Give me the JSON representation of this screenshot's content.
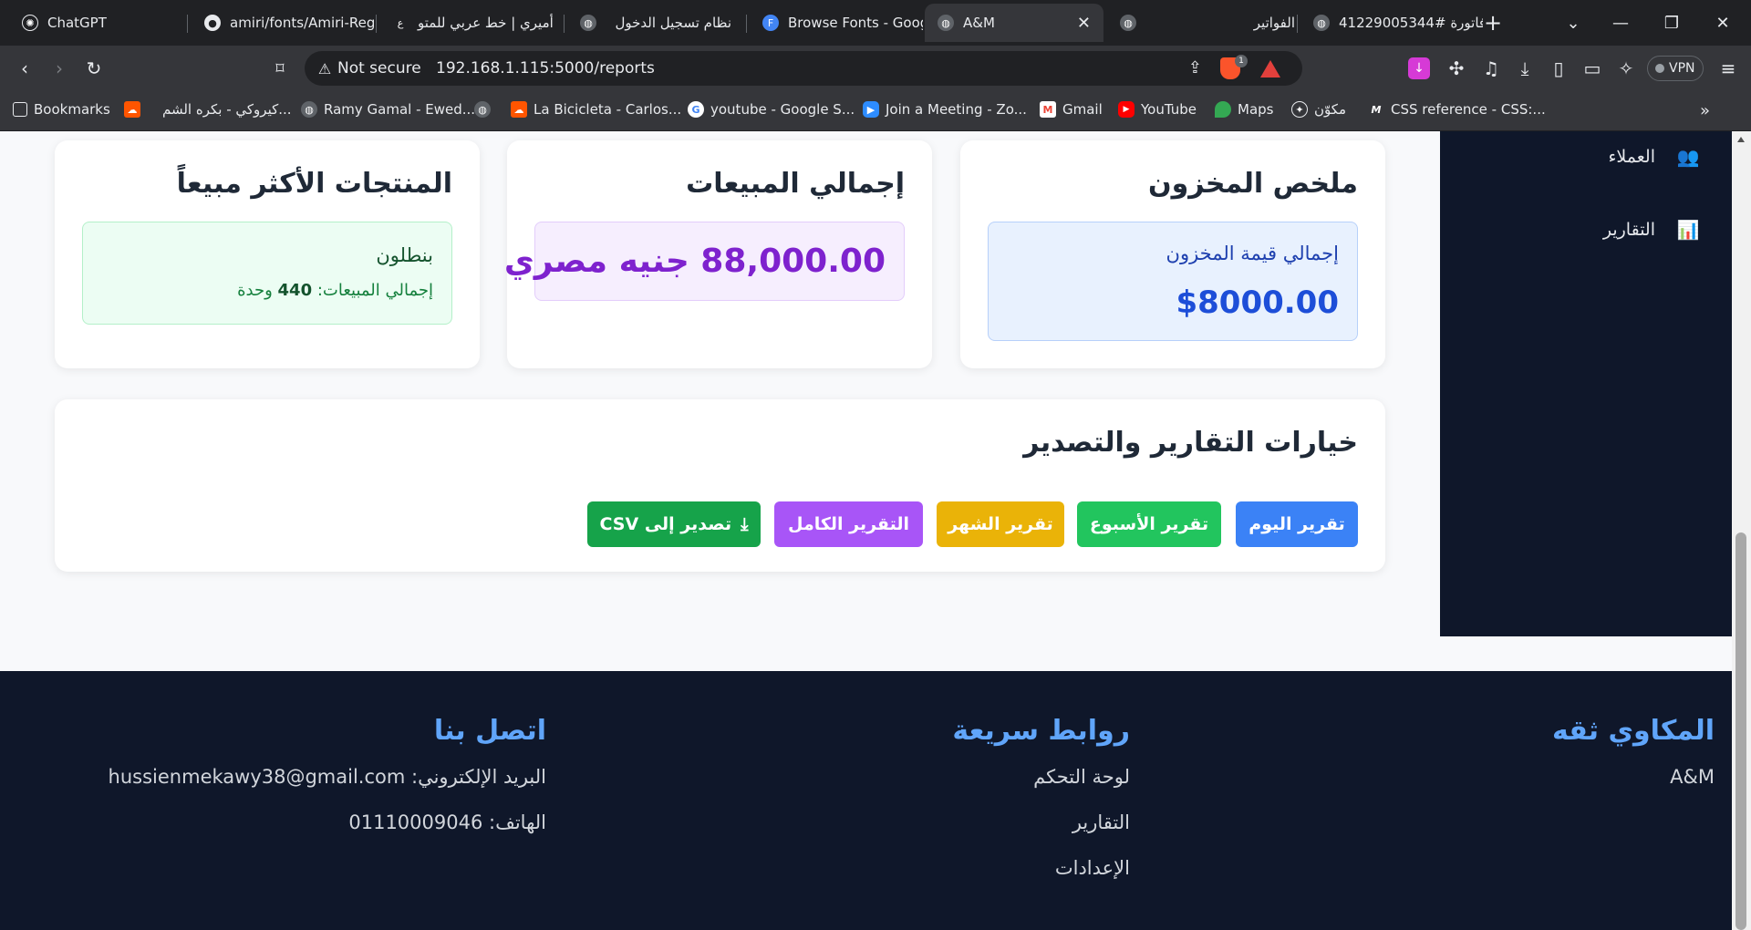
{
  "browser": {
    "tabs": [
      {
        "title": "ChatGPT"
      },
      {
        "title": "amiri/fonts/Amiri-Reg"
      },
      {
        "title": "أميري | خط عربي للمتو"
      },
      {
        "title": "نظام تسجيل الدخول"
      },
      {
        "title": "Browse Fonts - Goog"
      },
      {
        "title": "A&M"
      },
      {
        "title": "الفواتير"
      },
      {
        "title": "فاتورة #41229005344"
      }
    ],
    "address": {
      "security_label": "Not secure",
      "url": "192.168.1.115:5000/reports"
    },
    "brave_badge": "1",
    "vpn_label": "VPN",
    "bookmarks": [
      {
        "label": "Bookmarks"
      },
      {
        "label": "كيروكي - بكره الشم..."
      },
      {
        "label": "Ramy Gamal - Ewed..."
      },
      {
        "label": "La Bicicleta - Carlos..."
      },
      {
        "label": "youtube - Google S..."
      },
      {
        "label": "Join a Meeting - Zo..."
      },
      {
        "label": "Gmail"
      },
      {
        "label": "YouTube"
      },
      {
        "label": "Maps"
      },
      {
        "label": "مكوّن"
      },
      {
        "label": "CSS reference - CSS:..."
      }
    ]
  },
  "sidebar": {
    "items": [
      {
        "label": "العملاء",
        "icon": "users-icon"
      },
      {
        "label": "التقارير",
        "icon": "report-icon"
      }
    ]
  },
  "cards": {
    "inventory": {
      "title": "ملخص المخزون",
      "label": "إجمالي قيمة المخزون",
      "value": "$8000.00"
    },
    "sales": {
      "title": "إجمالي المبيعات",
      "value": "88,000.00 جنيه مصري"
    },
    "top_products": {
      "title": "المنتجات الأكثر مبيعاً",
      "product_name": "بنطلون",
      "sales_prefix": "إجمالي المبيعات:",
      "sales_count": "440",
      "sales_unit": "وحدة"
    }
  },
  "reports": {
    "title": "خيارات التقارير والتصدير",
    "buttons": {
      "today": "تقرير اليوم",
      "week": "تقرير الأسبوع",
      "month": "تقرير الشهر",
      "full": "التقرير الكامل",
      "export": "تصدير إلى CSV"
    }
  },
  "footer": {
    "brand": {
      "title": "المكاوي ثقه",
      "text": "A&M"
    },
    "links": {
      "title": "روابط سريعة",
      "items": [
        "لوحة التحكم",
        "التقارير",
        "الإعدادات"
      ]
    },
    "contact": {
      "title": "اتصل بنا",
      "email": "البريد الإلكتروني: hussienmekawy38@gmail.com",
      "phone": "الهاتف: 01110009046"
    }
  },
  "colors": {
    "today_btn": "#3b82f6",
    "week_btn": "#22c55e",
    "month_btn": "#eab308",
    "full_btn": "#a855f7",
    "export_btn": "#16a34a",
    "footer_bg": "#0f172a",
    "footer_heading": "#60a5fa"
  }
}
